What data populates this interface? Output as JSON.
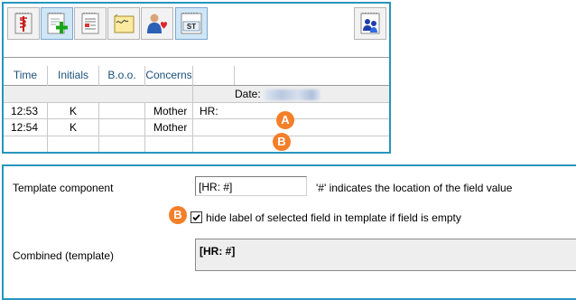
{
  "toolbar": {
    "buttons": [
      {
        "name": "caduceus-notes-icon",
        "active": false
      },
      {
        "name": "add-entry-icon",
        "active": true
      },
      {
        "name": "checklist-notes-icon",
        "active": false
      },
      {
        "name": "signature-note-icon",
        "active": false
      },
      {
        "name": "person-heart-icon",
        "active": false
      },
      {
        "name": "st-notes-icon",
        "active": true
      },
      {
        "name": "group-notes-icon",
        "active": false
      }
    ]
  },
  "table": {
    "headers": [
      "Time",
      "Initials",
      "B.o.o.",
      "Concerns",
      ""
    ],
    "date_label": "Date:",
    "rows": [
      {
        "time": "12:53",
        "initials": "K",
        "boo": "",
        "concerns": "Mother",
        "note": "HR:",
        "badge": "A"
      },
      {
        "time": "12:54",
        "initials": "K",
        "boo": "",
        "concerns": "Mother",
        "note": "",
        "badge": "B"
      }
    ]
  },
  "settings": {
    "template_component_label": "Template  component",
    "template_component_value": "[HR: #]",
    "field_hint": "'#' indicates the location of the field value",
    "hide_label_badge": "B",
    "hide_label_checked": true,
    "hide_label_text": "hide label of selected field in template if field is empty",
    "combined_label": "Combined (template)",
    "combined_value": "[HR: #]"
  },
  "colors": {
    "panel_border": "#2596be",
    "badge": "#f47f2a",
    "header_text": "#1b4f7a"
  }
}
